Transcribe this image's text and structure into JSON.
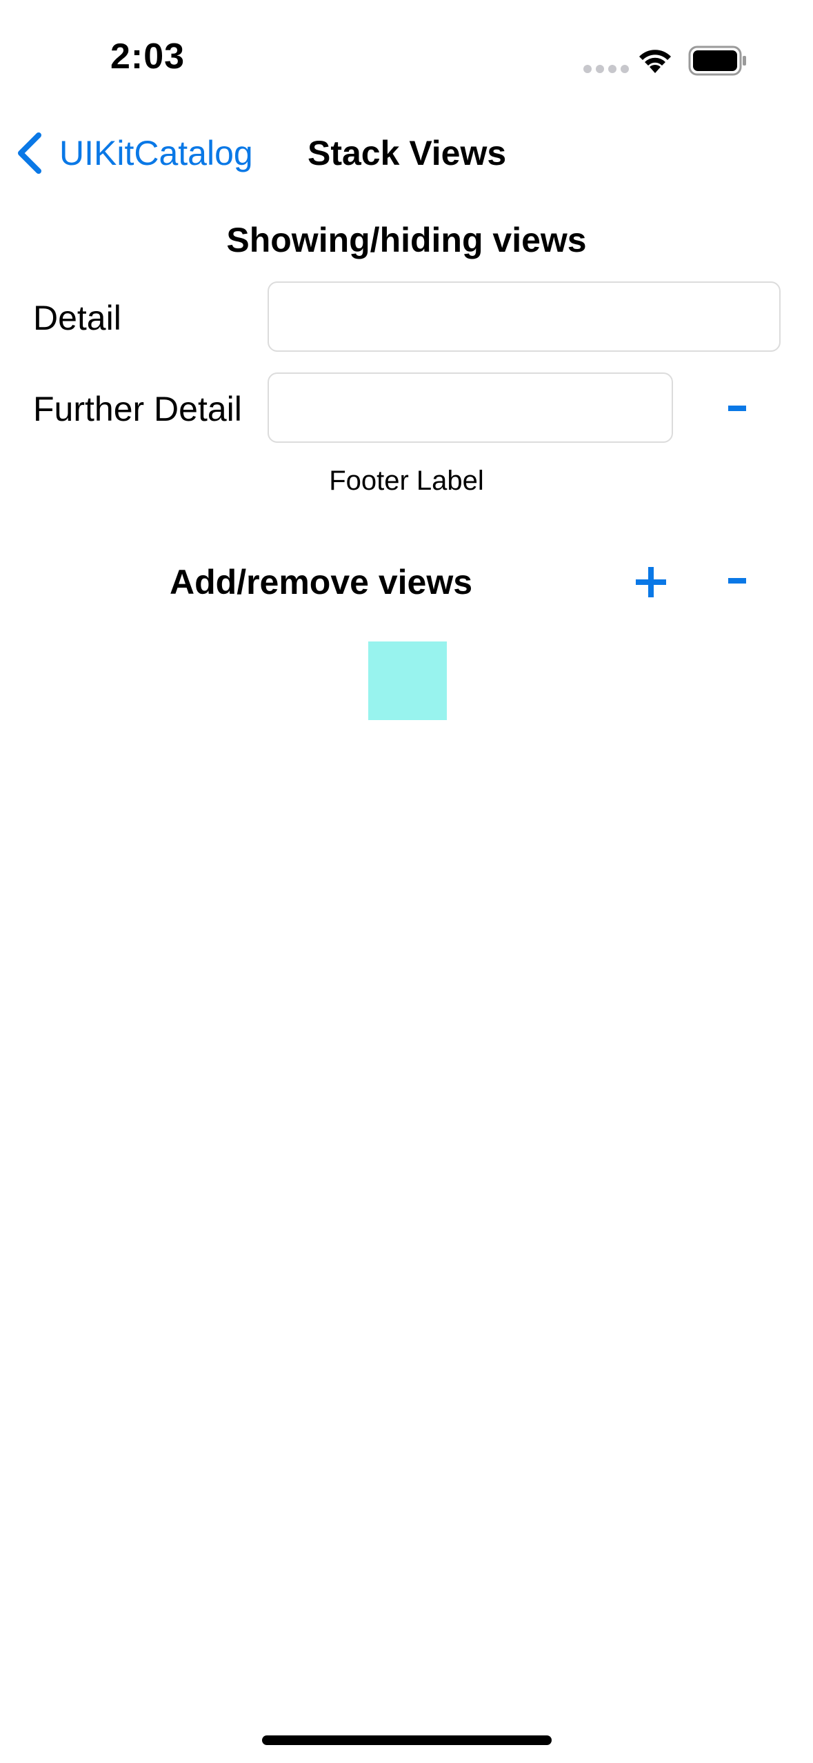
{
  "status_bar": {
    "time": "2:03",
    "icons": [
      "signal-dots-icon",
      "wifi-icon",
      "battery-icon"
    ]
  },
  "nav": {
    "back_label": "UIKitCatalog",
    "title": "Stack Views"
  },
  "showing_section": {
    "title": "Showing/hiding views",
    "detail_label": "Detail",
    "detail_value": "",
    "further_detail_label": "Further Detail",
    "further_detail_value": "",
    "minus_label": "-",
    "footer_label": "Footer Label"
  },
  "add_remove_section": {
    "title": "Add/remove views",
    "plus_label": "+",
    "minus_label": "-"
  },
  "colors": {
    "accent": "#0a78e6",
    "square": "#98f3ee"
  }
}
